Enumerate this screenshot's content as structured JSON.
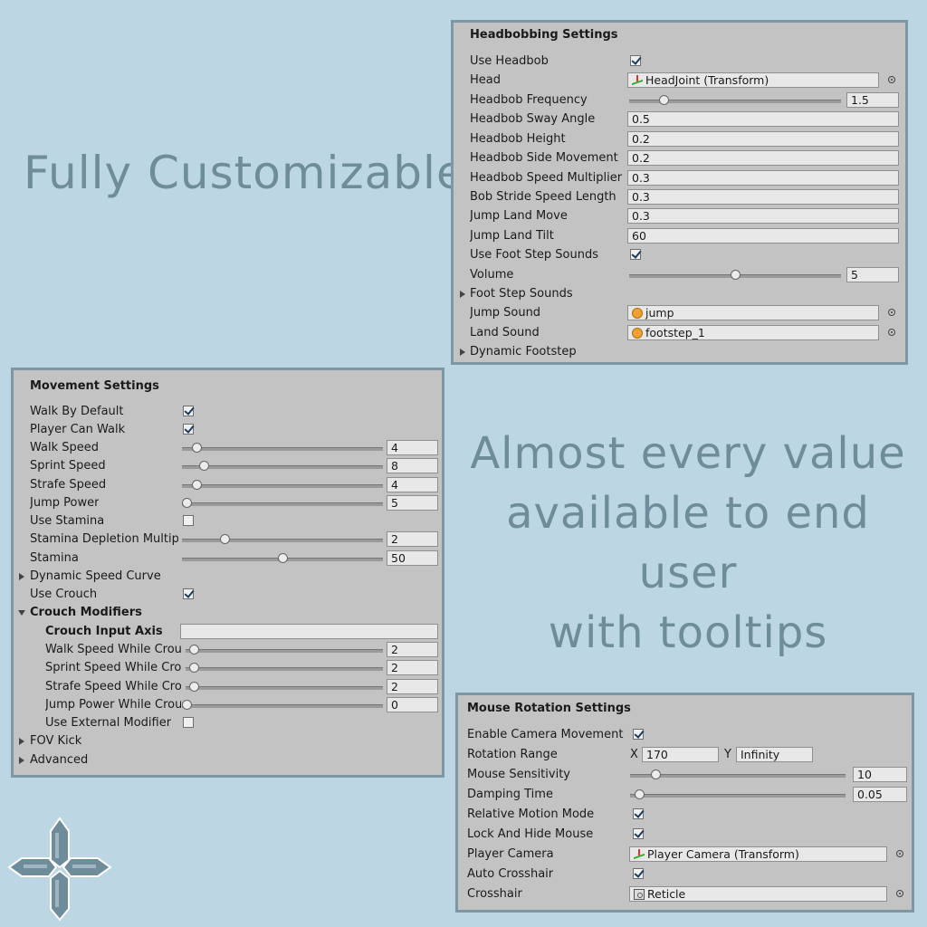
{
  "headlines": {
    "left": "Fully Customizable",
    "right": [
      "Almost every value",
      "available to end user",
      "with tooltips"
    ]
  },
  "headbob": {
    "title": "Headbobbing Settings",
    "use_headbob": "Use Headbob",
    "use_headbob_checked": true,
    "head": "Head",
    "head_value": "HeadJoint (Transform)",
    "frequency": "Headbob Frequency",
    "frequency_value": "1.5",
    "frequency_slider": 0.15,
    "sway_angle": "Headbob Sway Angle",
    "sway_angle_value": "0.5",
    "height": "Headbob Height",
    "height_value": "0.2",
    "side_movement": "Headbob Side Movement",
    "side_movement_value": "0.2",
    "speed_multiplier": "Headbob Speed Multiplier",
    "speed_multiplier_value": "0.3",
    "stride": "Bob Stride Speed Length",
    "stride_value": "0.3",
    "land_move": "Jump Land Move",
    "land_move_value": "0.3",
    "land_tilt": "Jump Land Tilt",
    "land_tilt_value": "60",
    "foot_step_sounds_toggle": "Use Foot Step Sounds",
    "foot_step_sounds_checked": true,
    "volume": "Volume",
    "volume_value": "5",
    "volume_slider": 0.5,
    "foot_step_sounds": "Foot Step Sounds",
    "jump_sound": "Jump Sound",
    "jump_sound_value": "jump",
    "land_sound": "Land Sound",
    "land_sound_value": "footstep_1",
    "dynamic_footstep": "Dynamic Footstep"
  },
  "movement": {
    "title": "Movement Settings",
    "walk_by_default": "Walk By Default",
    "walk_by_default_checked": true,
    "player_can_walk": "Player Can Walk",
    "player_can_walk_checked": true,
    "walk_speed": "Walk Speed",
    "walk_speed_value": "4",
    "walk_speed_slider": 0.05,
    "sprint_speed": "Sprint Speed",
    "sprint_speed_value": "8",
    "sprint_speed_slider": 0.09,
    "strafe_speed": "Strafe Speed",
    "strafe_speed_value": "4",
    "strafe_speed_slider": 0.05,
    "jump_power": "Jump Power",
    "jump_power_value": "5",
    "jump_power_slider": 0.0,
    "use_stamina": "Use Stamina",
    "use_stamina_checked": false,
    "stamina_depletion": "Stamina Depletion Multiplier",
    "stamina_depletion_value": "2",
    "stamina_depletion_slider": 0.2,
    "stamina": "Stamina",
    "stamina_value": "50",
    "stamina_slider": 0.5,
    "dynamic_speed_curve": "Dynamic Speed Curve",
    "use_crouch": "Use Crouch",
    "use_crouch_checked": true,
    "crouch_modifiers": "Crouch Modifiers",
    "crouch_input_axis": "Crouch Input Axis",
    "crouch_input_axis_value": "",
    "walk_while_crouched": "Walk Speed While Crouched",
    "walk_while_crouched_value": "2",
    "walk_while_crouched_slider": 0.02,
    "sprint_while_crouched": "Sprint Speed While Crouched",
    "sprint_while_crouched_value": "2",
    "sprint_while_crouched_slider": 0.02,
    "strafe_while_crouched": "Strafe Speed While Crouched",
    "strafe_while_crouched_value": "2",
    "strafe_while_crouched_slider": 0.02,
    "jump_while_crouched": "Jump Power While Crouched",
    "jump_while_crouched_value": "0",
    "jump_while_crouched_slider": 0.0,
    "use_external_modifier": "Use External Modifier",
    "use_external_modifier_checked": false,
    "fov_kick": "FOV Kick",
    "advanced": "Advanced"
  },
  "mouse": {
    "title": "Mouse Rotation Settings",
    "enable_camera": "Enable Camera Movement",
    "enable_camera_checked": true,
    "rotation_range": "Rotation Range",
    "x_label": "X",
    "x_value": "170",
    "y_label": "Y",
    "y_value": "Infinity",
    "sensitivity": "Mouse Sensitivity",
    "sensitivity_value": "10",
    "sensitivity_slider": 0.1,
    "damping": "Damping Time",
    "damping_value": "0.05",
    "damping_slider": 0.02,
    "relative_motion": "Relative Motion Mode",
    "relative_motion_checked": true,
    "lock_hide_mouse": "Lock And Hide Mouse",
    "lock_hide_mouse_checked": true,
    "player_camera": "Player Camera",
    "player_camera_value": "Player Camera (Transform)",
    "auto_crosshair": "Auto Crosshair",
    "auto_crosshair_checked": true,
    "crosshair": "Crosshair",
    "crosshair_value": "Reticle"
  }
}
